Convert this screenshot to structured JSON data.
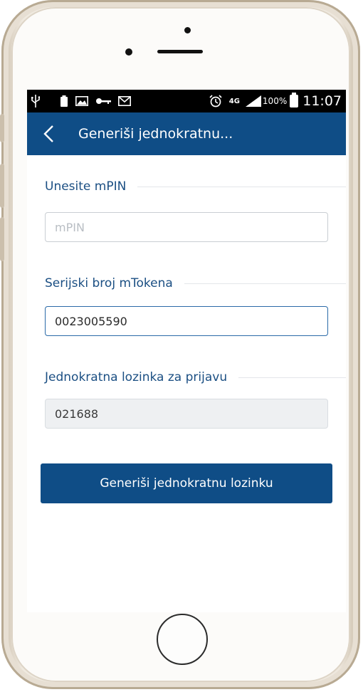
{
  "status_bar": {
    "network": "4G",
    "battery": "100%",
    "time": "11:07"
  },
  "app_bar": {
    "title": "Generiši jednokratnu..."
  },
  "form": {
    "mpin_label": "Unesite mPIN",
    "mpin_placeholder": "mPIN",
    "mpin_value": "",
    "serial_label": "Serijski broj mTokena",
    "serial_value": "0023005590",
    "otp_label": "Jednokratna lozinka za prijavu",
    "otp_value": "021688"
  },
  "actions": {
    "generate_label": "Generiši jednokratnu lozinku"
  },
  "colors": {
    "primary": "#0f4d86",
    "label": "#1b4f83"
  }
}
